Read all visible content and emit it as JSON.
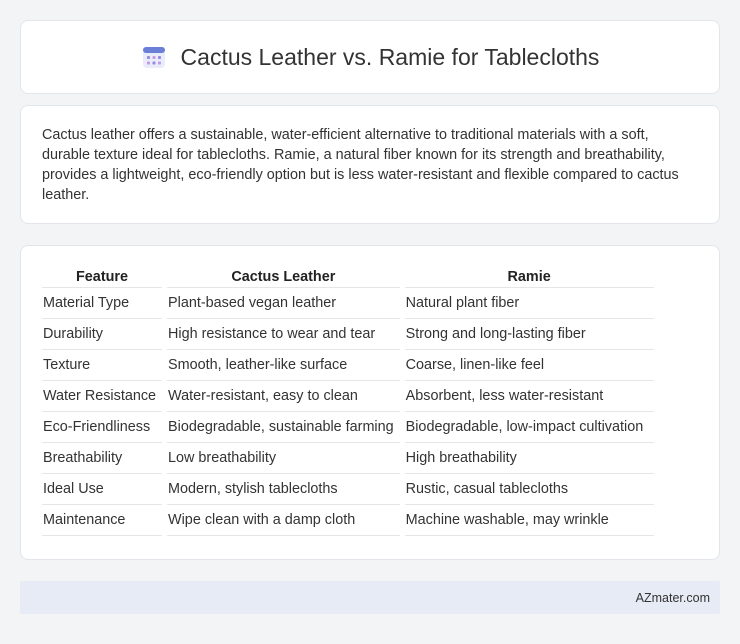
{
  "header": {
    "icon": "calendar-icon",
    "title": "Cactus Leather vs. Ramie for Tablecloths"
  },
  "intro": {
    "text": "Cactus leather offers a sustainable, water-efficient alternative to traditional materials with a soft, durable texture ideal for tablecloths. Ramie, a natural fiber known for its strength and breathability, provides a lightweight, eco-friendly option but is less water-resistant and flexible compared to cactus leather."
  },
  "table": {
    "headers": [
      "Feature",
      "Cactus Leather",
      "Ramie"
    ],
    "rows": [
      [
        "Material Type",
        "Plant-based vegan leather",
        "Natural plant fiber"
      ],
      [
        "Durability",
        "High resistance to wear and tear",
        "Strong and long-lasting fiber"
      ],
      [
        "Texture",
        "Smooth, leather-like surface",
        "Coarse, linen-like feel"
      ],
      [
        "Water Resistance",
        "Water-resistant, easy to clean",
        "Absorbent, less water-resistant"
      ],
      [
        "Eco-Friendliness",
        "Biodegradable, sustainable farming",
        "Biodegradable, low-impact cultivation"
      ],
      [
        "Breathability",
        "Low breathability",
        "High breathability"
      ],
      [
        "Ideal Use",
        "Modern, stylish tablecloths",
        "Rustic, casual tablecloths"
      ],
      [
        "Maintenance",
        "Wipe clean with a damp cloth",
        "Machine washable, may wrinkle"
      ]
    ]
  },
  "footer": {
    "text": "AZmater.com"
  },
  "colors": {
    "background": "#f3f4f6",
    "card": "#ffffff",
    "footer": "#e6ebf5",
    "icon_accent": "#6b7fd7"
  }
}
